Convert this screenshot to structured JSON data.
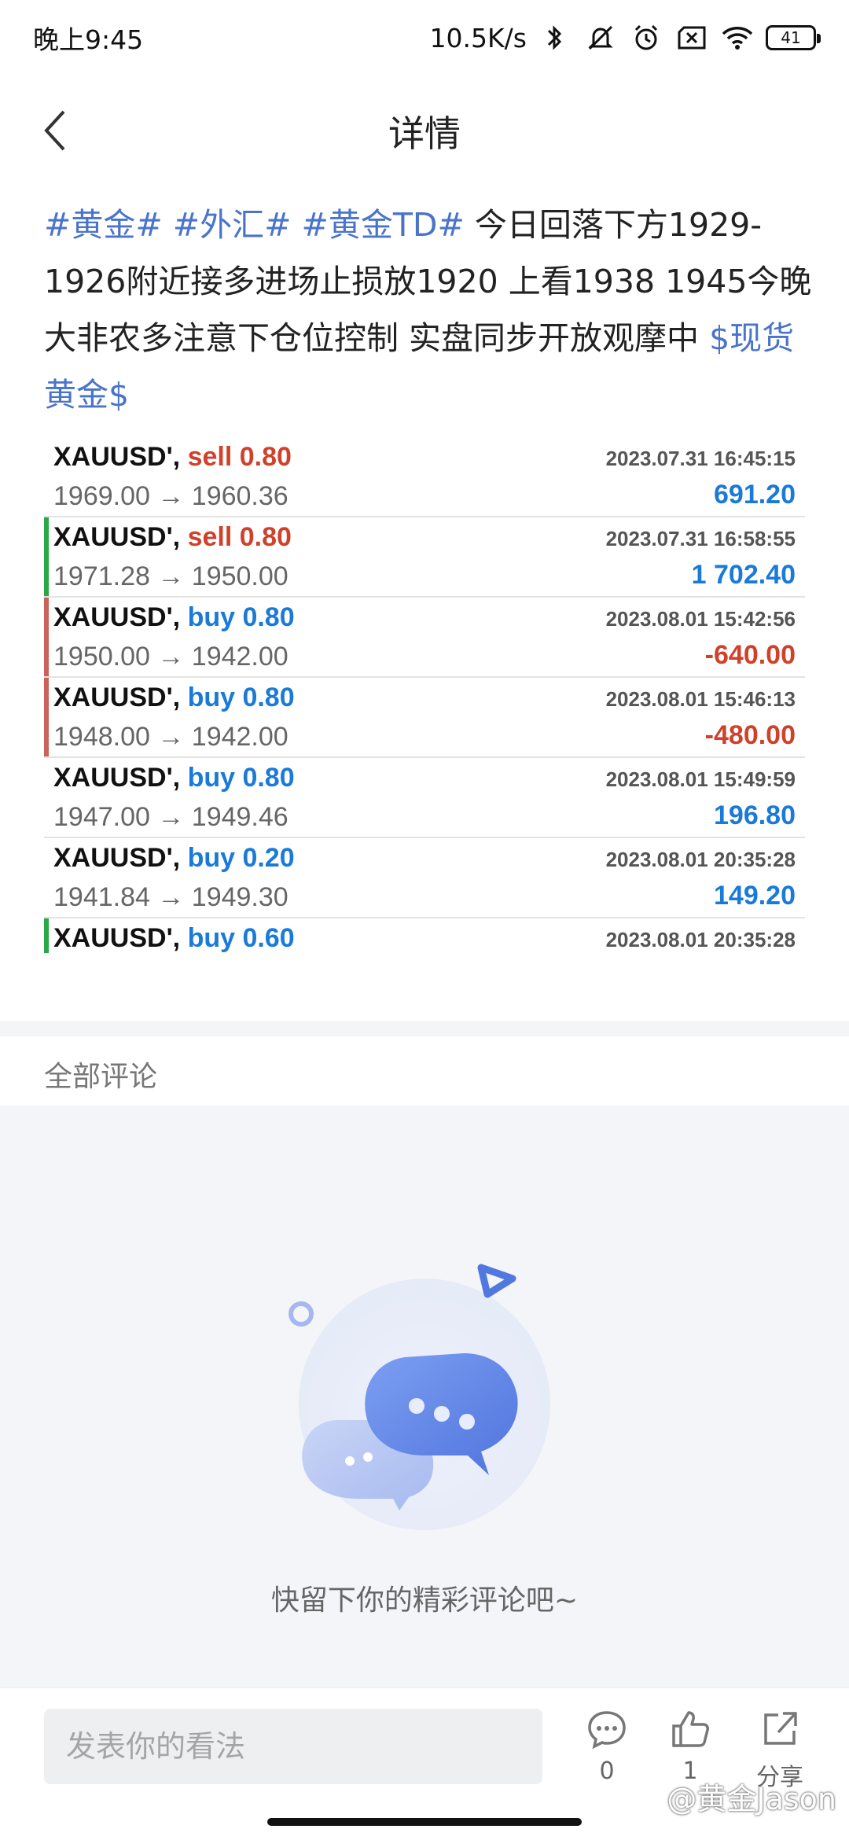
{
  "status_bar": {
    "time": "晚上9:45",
    "net_speed": "10.5K/s",
    "battery": "41"
  },
  "nav": {
    "title": "详情"
  },
  "post": {
    "tag1": "#黄金#",
    "tag2": "#外汇#",
    "tag3": "#黄金TD#",
    "text": "今日回落下方1929-1926附近接多进场止损放1920 上看1938 1945今晚大非农多注意下仓位控制 实盘同步开放观摩中",
    "tag4": "$现货黄金$"
  },
  "trades": [
    {
      "symbol": "XAUUSD',",
      "side": "sell 0.80",
      "time": "2023.07.31 16:45:15",
      "prices": "1969.00 → 1960.36",
      "profit": "691.20"
    },
    {
      "symbol": "XAUUSD',",
      "side": "sell 0.80",
      "time": "2023.07.31 16:58:55",
      "prices": "1971.28 → 1950.00",
      "profit": "1 702.40"
    },
    {
      "symbol": "XAUUSD',",
      "side": "buy 0.80",
      "time": "2023.08.01 15:42:56",
      "prices": "1950.00 → 1942.00",
      "profit": "-640.00"
    },
    {
      "symbol": "XAUUSD',",
      "side": "buy 0.80",
      "time": "2023.08.01 15:46:13",
      "prices": "1948.00 → 1942.00",
      "profit": "-480.00"
    },
    {
      "symbol": "XAUUSD',",
      "side": "buy 0.80",
      "time": "2023.08.01 15:49:59",
      "prices": "1947.00 → 1949.46",
      "profit": "196.80"
    },
    {
      "symbol": "XAUUSD',",
      "side": "buy 0.20",
      "time": "2023.08.01 20:35:28",
      "prices": "1941.84 → 1949.30",
      "profit": "149.20"
    },
    {
      "symbol": "XAUUSD',",
      "side": "buy 0.60",
      "time": "2023.08.01 20:35:28",
      "prices": "",
      "profit": ""
    }
  ],
  "colors": {
    "sell": "#d0412c",
    "buy": "#1a7ad8",
    "profit_pos": "#1a7ad8",
    "profit_neg": "#d0412c",
    "bar_green": "#2aa845",
    "bar_red": "#c9625b"
  },
  "comments": {
    "title": "全部评论",
    "empty_text": "快留下你的精彩评论吧~"
  },
  "bottom_bar": {
    "input_placeholder": "发表你的看法",
    "comment_count": "0",
    "like_count": "1",
    "share_label": "分享",
    "comment_icon": "comment-bubble-icon",
    "like_icon": "thumbs-up-icon",
    "share_icon": "share-icon"
  },
  "watermark": "@黄金Jason"
}
